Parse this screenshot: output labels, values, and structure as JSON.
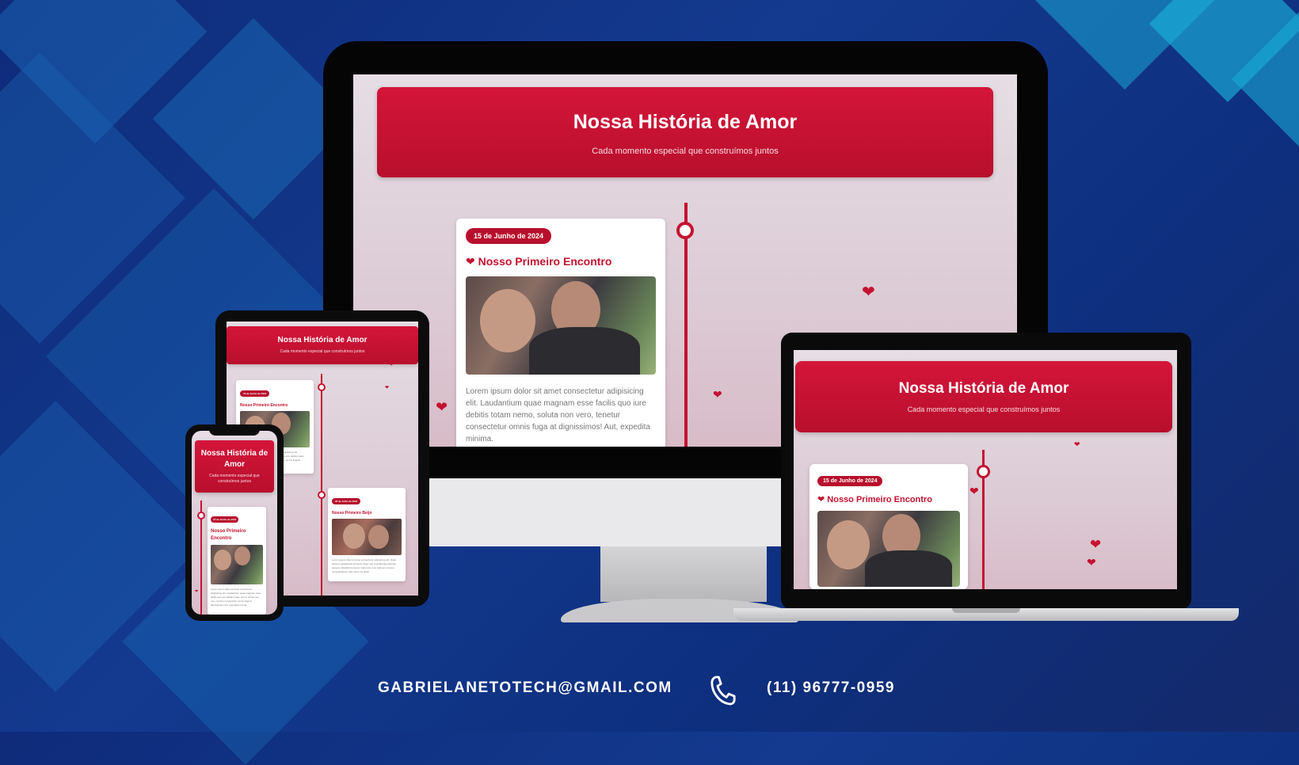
{
  "site": {
    "title": "Nossa História de Amor",
    "subtitle": "Cada momento especial que construímos juntos",
    "timeline": [
      {
        "date": "15 de Junho de 2024",
        "title": "Nosso Primeiro Encontro",
        "text": "Lorem ipsum dolor sit amet consectetur adipisicing elit. Laudantium quae magnam esse facilis quo iure debitis totam nemo, soluta non vero, tenetur consectetur omnis fuga at dignissimos! Aut, expedita minima."
      },
      {
        "date": "20 de Julho de 2024",
        "title": "Nosso Primeiro Beijo",
        "text": "Lorem ipsum dolor sit amet consectetur adipisicing elit. Quas dolores repellendus at harum fuga, quo repudiandae aliquam tempore blanditiis tempore nulla iusto sunt rationem ratione necessitatibus! Nam porro ea dolor!"
      }
    ]
  },
  "contact": {
    "email": "GABRIELANETOTECH@GMAIL.COM",
    "phone": "(11) 96777-0959"
  },
  "icons": {
    "heart": "heart-icon",
    "phone": "phone-icon"
  },
  "colors": {
    "brand_red": "#c41230",
    "background_blue": "#133a8f"
  }
}
